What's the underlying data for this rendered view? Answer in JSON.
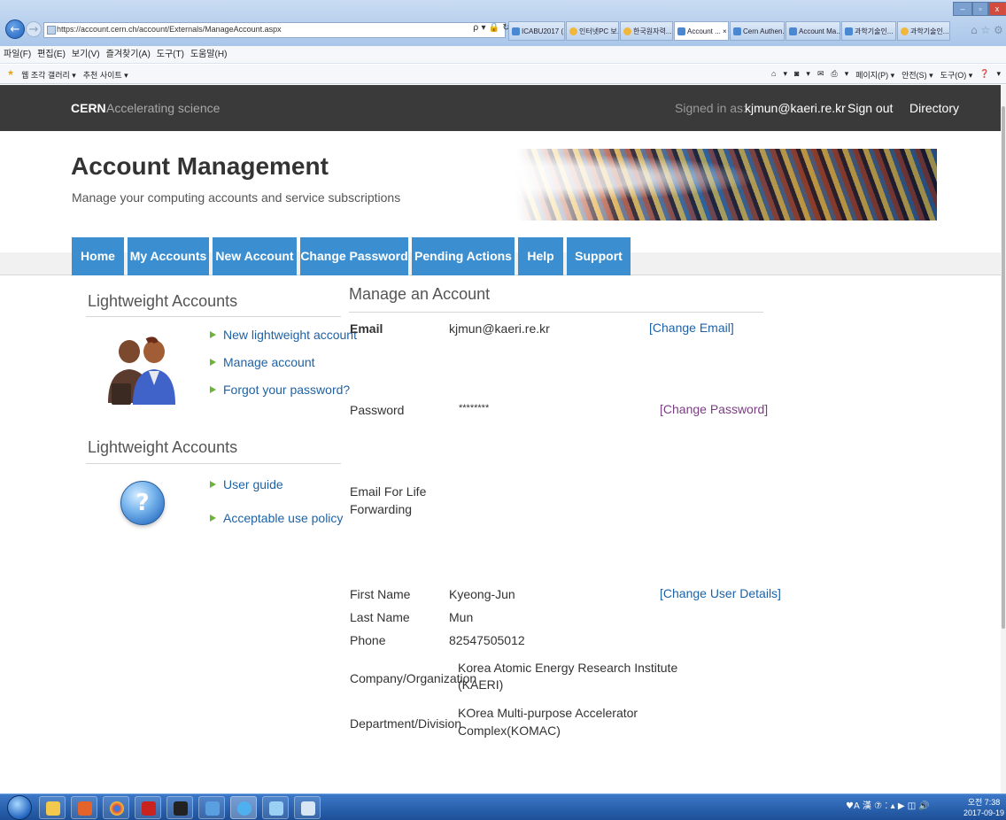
{
  "browser": {
    "address": "https://account.cern.ch/account/Externals/ManageAccount.aspx",
    "address_tools": "ρ ▾ 🔒 ↻",
    "tabs": [
      {
        "label": "ICABU2017 (..."
      },
      {
        "label": "인터넷PC 보..."
      },
      {
        "label": "한국원자력..."
      },
      {
        "label": "Account ... ×"
      },
      {
        "label": "Cern Authen..."
      },
      {
        "label": "Account Ma..."
      },
      {
        "label": "과학기술인..."
      },
      {
        "label": "과학기술인..."
      }
    ],
    "menu": [
      "파일(F)",
      "편집(E)",
      "보기(V)",
      "즐겨찾기(A)",
      "도구(T)",
      "도움말(H)"
    ],
    "favorites": [
      "웹 조각 갤러리 ▾",
      "추천 사이트 ▾"
    ],
    "command_bar": [
      "▾",
      "▾",
      "▾",
      "페이지(P) ▾",
      "안전(S) ▾",
      "도구(O) ▾",
      "▾"
    ]
  },
  "header": {
    "brand": "CERN",
    "tagline": "Accelerating science",
    "signed_label": "Signed in as:",
    "user": "kjmun@kaeri.re.kr",
    "sign_out": "Sign out",
    "directory": "Directory"
  },
  "page": {
    "title": "Account Management",
    "subtitle": "Manage your computing accounts and service subscriptions"
  },
  "nav": [
    {
      "label": "Home"
    },
    {
      "label": "My Accounts"
    },
    {
      "label": "New Account"
    },
    {
      "label": "Change Password"
    },
    {
      "label": "Pending Actions"
    },
    {
      "label": "Help"
    },
    {
      "label": "Support"
    }
  ],
  "sidebar": {
    "section1": {
      "heading": "Lightweight Accounts",
      "links": [
        "New lightweight account",
        "Manage account",
        "Forgot your password?"
      ]
    },
    "section2": {
      "heading": "Lightweight Accounts",
      "links": [
        "User guide",
        "Acceptable use policy"
      ]
    }
  },
  "main": {
    "heading": "Manage an Account",
    "email": {
      "label": "Email",
      "value": "kjmun@kaeri.re.kr",
      "action": "[Change Email]"
    },
    "password": {
      "label": "Password",
      "value": "********",
      "action": "[Change Password]"
    },
    "forwarding": {
      "label_line1": "Email For Life",
      "label_line2": "Forwarding"
    },
    "details": {
      "first_name": {
        "label": "First Name",
        "value": "Kyeong-Jun"
      },
      "last_name": {
        "label": "Last Name",
        "value": "Mun"
      },
      "phone": {
        "label": "Phone",
        "value": "82547505012"
      },
      "company": {
        "label": "Company/Organization",
        "value_line1": "Korea Atomic Energy Research Institute",
        "value_line2": "(KAERI)"
      },
      "department": {
        "label": "Department/Division",
        "value_line1": "KOrea Multi-purpose Accelerator",
        "value_line2": "Complex(KOMAC)"
      },
      "action": "[Change User Details]"
    }
  },
  "taskbar": {
    "tray": "♥A 漢 ⑦ ⁚ ▴ ▶ ◫ 🔊",
    "time": "오전 7:38",
    "date": "2017-09-19"
  },
  "colors": {
    "nav_blue": "#3b8fd0",
    "link_blue": "#1d62a6",
    "header_dark": "#3a3a3a",
    "bullet_green": "#6bb33b"
  }
}
